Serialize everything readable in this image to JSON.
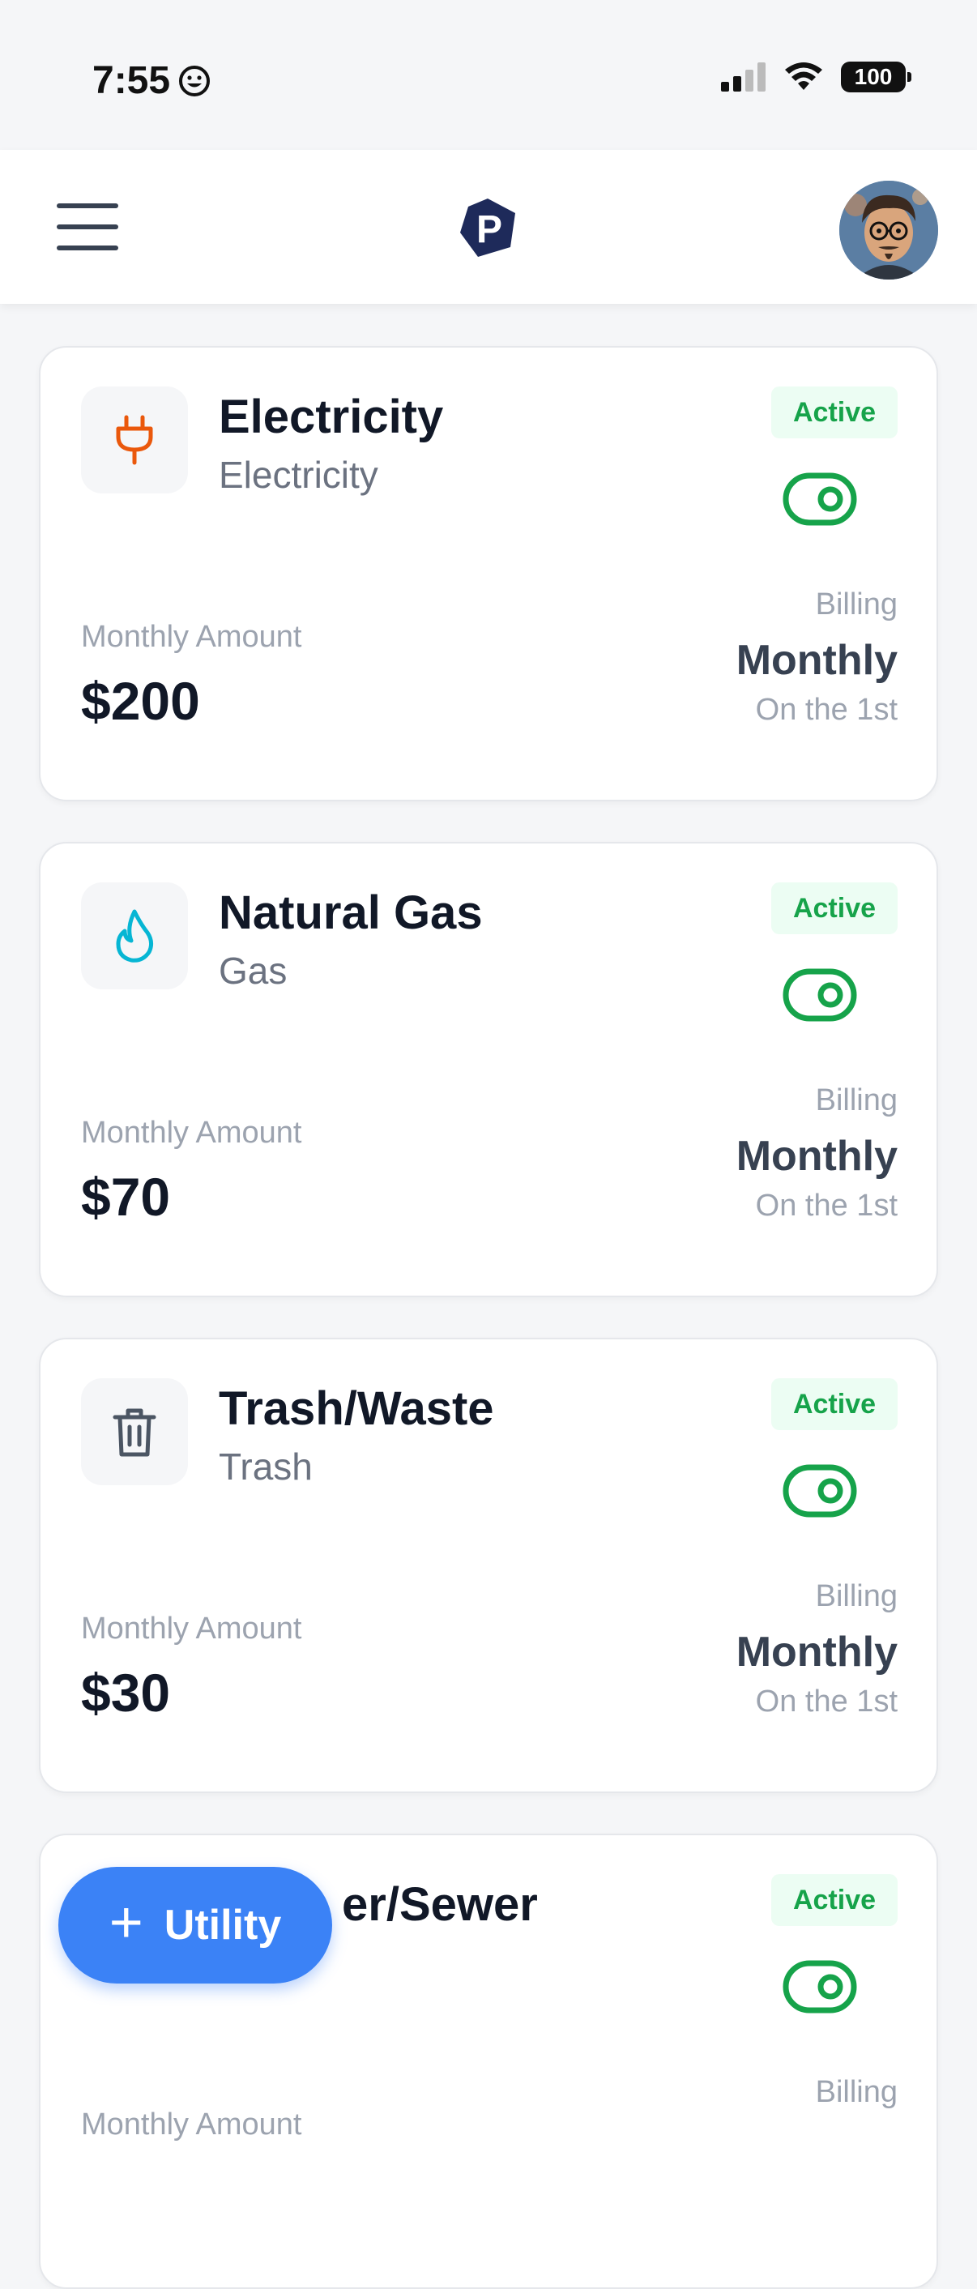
{
  "status_bar": {
    "time": "7:55",
    "emoji": "☺",
    "battery": "100"
  },
  "header": {
    "menu_icon": "hamburger-menu-icon",
    "logo_letter": "P",
    "avatar": "user-avatar"
  },
  "utilities": [
    {
      "title": "Electricity",
      "subtitle": "Electricity",
      "icon": "plug-icon",
      "icon_color": "#ea580c",
      "status": "Active",
      "amount_label": "Monthly Amount",
      "amount": "$200",
      "billing_label": "Billing",
      "billing_frequency": "Monthly",
      "billing_day": "On the 1st"
    },
    {
      "title": "Natural Gas",
      "subtitle": "Gas",
      "icon": "flame-icon",
      "icon_color": "#06b6d4",
      "status": "Active",
      "amount_label": "Monthly Amount",
      "amount": "$70",
      "billing_label": "Billing",
      "billing_frequency": "Monthly",
      "billing_day": "On the 1st"
    },
    {
      "title": "Trash/Waste",
      "subtitle": "Trash",
      "icon": "trash-icon",
      "icon_color": "#4b5563",
      "status": "Active",
      "amount_label": "Monthly Amount",
      "amount": "$30",
      "billing_label": "Billing",
      "billing_frequency": "Monthly",
      "billing_day": "On the 1st"
    },
    {
      "title": "Water/Sewer",
      "title_visible": "er/Sewer",
      "status": "Active",
      "amount_label": "Monthly Amount",
      "billing_label": "Billing"
    }
  ],
  "fab": {
    "icon": "plus-icon",
    "label": "Utility"
  },
  "colors": {
    "accent": "#3b82f6",
    "active_green": "#16a34a",
    "active_bg": "#ecfdf3"
  }
}
